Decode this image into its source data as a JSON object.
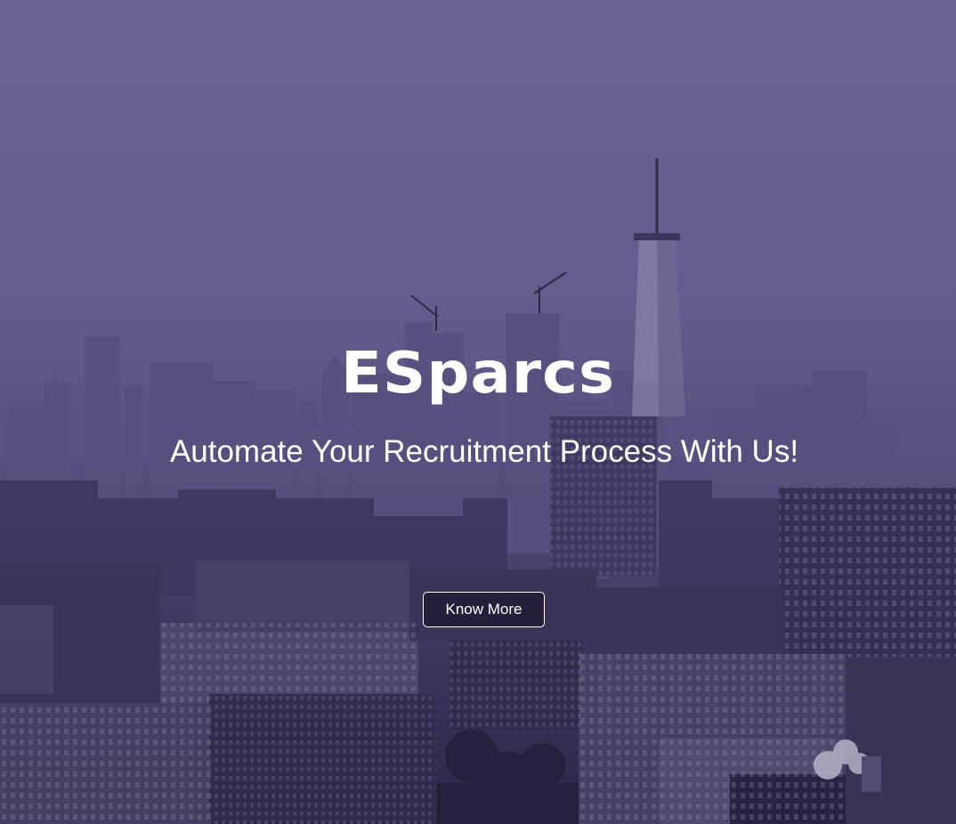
{
  "hero": {
    "brand": "ESparcs",
    "tagline": "Automate Your Recruitment Process With Us!",
    "cta_label": "Know More",
    "background_image": "city-skyline-photo"
  },
  "colors": {
    "sky": "#74709c",
    "overlay": "#3c326e",
    "text": "#ffffff"
  }
}
